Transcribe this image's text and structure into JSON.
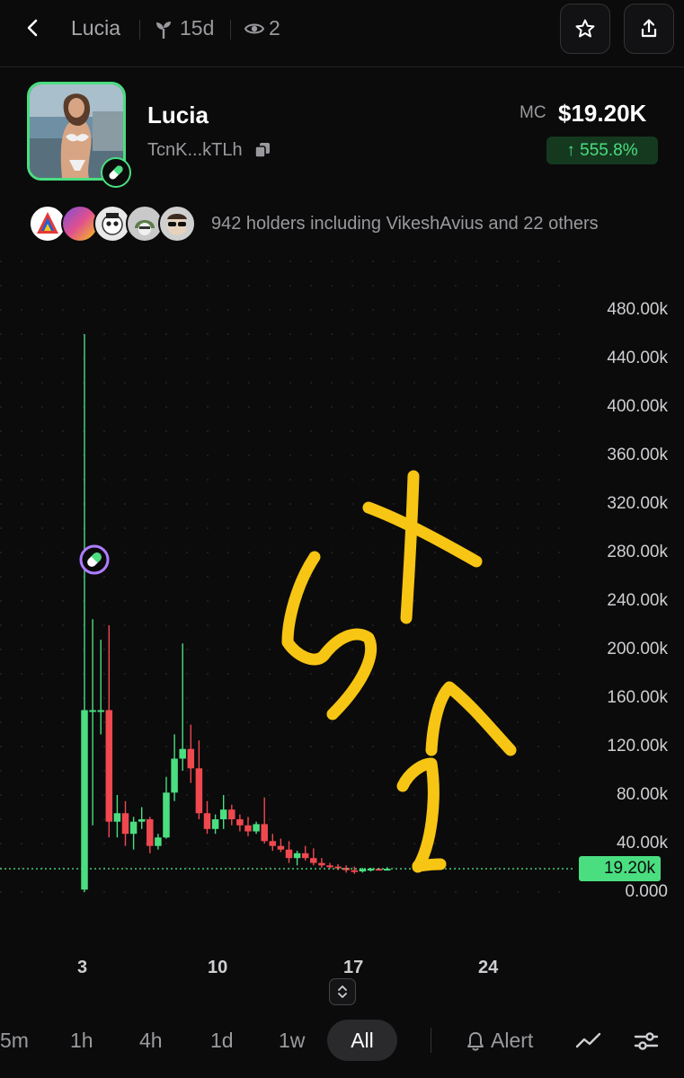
{
  "header": {
    "title": "Lucia",
    "age": "15d",
    "watchers": "2"
  },
  "token": {
    "name": "Lucia",
    "address": "TcnK...kTLh",
    "mc_label": "MC",
    "mc_value": "$19.20K",
    "change": "↑ 555.8%"
  },
  "holders": {
    "text": "942 holders including VikeshAvius and 22 others",
    "avatars": [
      "avatar-triangle-logo",
      "avatar-colorful",
      "avatar-skull",
      "avatar-helmet",
      "avatar-sunglasses"
    ]
  },
  "chart_data": {
    "type": "candlestick",
    "y_ticks": [
      "480.00k",
      "440.00k",
      "400.00k",
      "360.00k",
      "320.00k",
      "280.00k",
      "240.00k",
      "200.00k",
      "160.00k",
      "120.00k",
      "80.00k",
      "40.00k",
      "0.000"
    ],
    "x_ticks": [
      "3",
      "10",
      "17",
      "24"
    ],
    "ylim": [
      0,
      480000
    ],
    "current_price_label": "19.20k",
    "current_value": 19200,
    "colors": {
      "up": "#4ade80",
      "down": "#f0484f",
      "annotation": "#f7c513"
    },
    "candles": [
      {
        "o": 2000,
        "h": 460000,
        "l": 0,
        "c": 150000
      },
      {
        "o": 150000,
        "h": 225000,
        "l": 55000,
        "c": 150000
      },
      {
        "o": 150000,
        "h": 208000,
        "l": 130000,
        "c": 150000
      },
      {
        "o": 150000,
        "h": 220000,
        "l": 45000,
        "c": 58000
      },
      {
        "o": 58000,
        "h": 80000,
        "l": 45000,
        "c": 65000
      },
      {
        "o": 65000,
        "h": 75000,
        "l": 38000,
        "c": 48000
      },
      {
        "o": 48000,
        "h": 62000,
        "l": 35000,
        "c": 58000
      },
      {
        "o": 58000,
        "h": 70000,
        "l": 52000,
        "c": 60000
      },
      {
        "o": 60000,
        "h": 62000,
        "l": 32000,
        "c": 38000
      },
      {
        "o": 38000,
        "h": 48000,
        "l": 35000,
        "c": 45000
      },
      {
        "o": 45000,
        "h": 95000,
        "l": 44000,
        "c": 82000
      },
      {
        "o": 82000,
        "h": 130000,
        "l": 75000,
        "c": 110000
      },
      {
        "o": 110000,
        "h": 205000,
        "l": 100000,
        "c": 118000
      },
      {
        "o": 118000,
        "h": 138000,
        "l": 90000,
        "c": 102000
      },
      {
        "o": 102000,
        "h": 125000,
        "l": 60000,
        "c": 65000
      },
      {
        "o": 65000,
        "h": 75000,
        "l": 48000,
        "c": 52000
      },
      {
        "o": 52000,
        "h": 64000,
        "l": 48000,
        "c": 60000
      },
      {
        "o": 60000,
        "h": 80000,
        "l": 52000,
        "c": 68000
      },
      {
        "o": 68000,
        "h": 72000,
        "l": 55000,
        "c": 60000
      },
      {
        "o": 60000,
        "h": 64000,
        "l": 50000,
        "c": 55000
      },
      {
        "o": 55000,
        "h": 62000,
        "l": 46000,
        "c": 50000
      },
      {
        "o": 50000,
        "h": 58000,
        "l": 48000,
        "c": 56000
      },
      {
        "o": 56000,
        "h": 78000,
        "l": 40000,
        "c": 42000
      },
      {
        "o": 42000,
        "h": 48000,
        "l": 34000,
        "c": 38000
      },
      {
        "o": 38000,
        "h": 44000,
        "l": 33000,
        "c": 35000
      },
      {
        "o": 35000,
        "h": 42000,
        "l": 24000,
        "c": 28000
      },
      {
        "o": 28000,
        "h": 34000,
        "l": 22000,
        "c": 32000
      },
      {
        "o": 32000,
        "h": 38000,
        "l": 26000,
        "c": 28000
      },
      {
        "o": 28000,
        "h": 36000,
        "l": 22000,
        "c": 24000
      },
      {
        "o": 24000,
        "h": 28000,
        "l": 20000,
        "c": 22000
      },
      {
        "o": 22000,
        "h": 24000,
        "l": 19000,
        "c": 21000
      },
      {
        "o": 21000,
        "h": 23000,
        "l": 18000,
        "c": 20000
      },
      {
        "o": 20000,
        "h": 22000,
        "l": 16000,
        "c": 18000
      },
      {
        "o": 18000,
        "h": 21000,
        "l": 15000,
        "c": 17000
      },
      {
        "o": 17000,
        "h": 20000,
        "l": 16000,
        "c": 19000
      },
      {
        "o": 19000,
        "h": 20000,
        "l": 17000,
        "c": 19200
      },
      {
        "o": 19200,
        "h": 20000,
        "l": 18000,
        "c": 19000
      },
      {
        "o": 19000,
        "h": 20500,
        "l": 18500,
        "c": 19200
      }
    ]
  },
  "timeframes": [
    "5m",
    "1h",
    "4h",
    "1d",
    "1w"
  ],
  "active_timeframe": "All",
  "alert_label": "Alert",
  "icons": {
    "back": "chevron-left-icon",
    "age": "sprout-icon",
    "watchers": "eye-icon",
    "star": "star-icon",
    "share": "share-icon",
    "copy": "copy-icon",
    "pill": "pill-icon",
    "expand": "expand-icon",
    "bell": "bell-icon",
    "line_chart": "line-chart-icon",
    "settings": "sliders-icon"
  }
}
